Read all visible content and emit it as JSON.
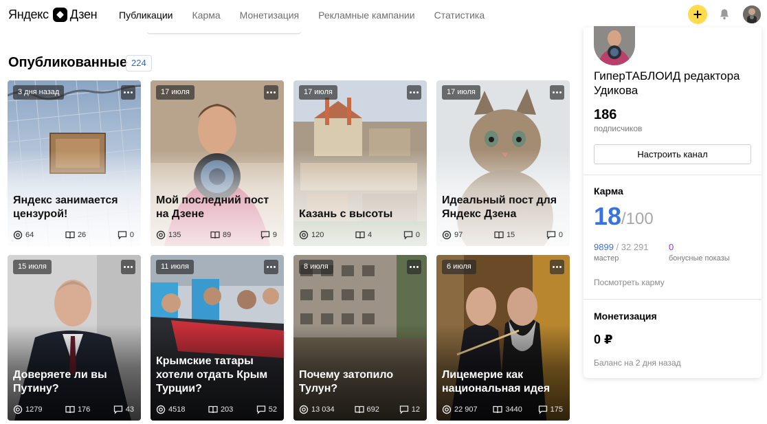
{
  "header": {
    "logo_left": "Яндекс",
    "logo_right": "Дзен",
    "nav": [
      {
        "label": "Публикации",
        "active": true
      },
      {
        "label": "Карма",
        "active": false
      },
      {
        "label": "Монетизация",
        "active": false
      },
      {
        "label": "Рекламные кампании",
        "active": false
      },
      {
        "label": "Статистика",
        "active": false
      }
    ],
    "add_icon": "plus-icon",
    "notifications_icon": "bell-icon"
  },
  "published": {
    "title": "Опубликованные",
    "count": "224"
  },
  "cards": [
    {
      "date": "3 дня назад",
      "title": "Яндекс занимается цензурой!",
      "views": "64",
      "reads": "26",
      "comments": "0",
      "scene": "fence"
    },
    {
      "date": "17 июля",
      "title": "Мой последний пост на Дзене",
      "views": "135",
      "reads": "89",
      "comments": "9",
      "scene": "portrait"
    },
    {
      "date": "17 июля",
      "title": "Казань с высоты",
      "views": "120",
      "reads": "4",
      "comments": "0",
      "scene": "city"
    },
    {
      "date": "17 июля",
      "title": "Идеальный пост для Яндекс Дзена",
      "views": "97",
      "reads": "15",
      "comments": "0",
      "scene": "kitten"
    },
    {
      "date": "15 июля",
      "title": "Доверяете ли вы Путину?",
      "views": "1279",
      "reads": "176",
      "comments": "43",
      "scene": "suit"
    },
    {
      "date": "11 июля",
      "title": "Крымские татары хотели отдать Крым Турции?",
      "views": "4518",
      "reads": "203",
      "comments": "52",
      "scene": "crowd"
    },
    {
      "date": "8 июля",
      "title": "Почему затопило Тулун?",
      "views": "13 034",
      "reads": "692",
      "comments": "12",
      "scene": "flood"
    },
    {
      "date": "6 июля",
      "title": "Лицемерие как национальная идея",
      "views": "22 907",
      "reads": "3440",
      "comments": "175",
      "scene": "church"
    }
  ],
  "channel": {
    "name": "ГиперТАБЛОИД редактора Удикова",
    "subscribers": "186",
    "subscribers_label": "подписчиков",
    "configure_button": "Настроить канал"
  },
  "karma": {
    "title": "Карма",
    "value": "18",
    "max": "/100",
    "master_value": "9899",
    "master_total": "/ 32 291",
    "master_label": "мастер",
    "bonus_value": "0",
    "bonus_label": "бонусные показы",
    "link": "Посмотреть карму"
  },
  "monetization": {
    "title": "Монетизация",
    "amount": "0 ₽",
    "note": "Баланс на 2 дня назад"
  },
  "colors": {
    "accent_blue": "#3973e0",
    "plus_yellow": "#ffdb4d",
    "bonus_purple": "#8a3bd0"
  }
}
